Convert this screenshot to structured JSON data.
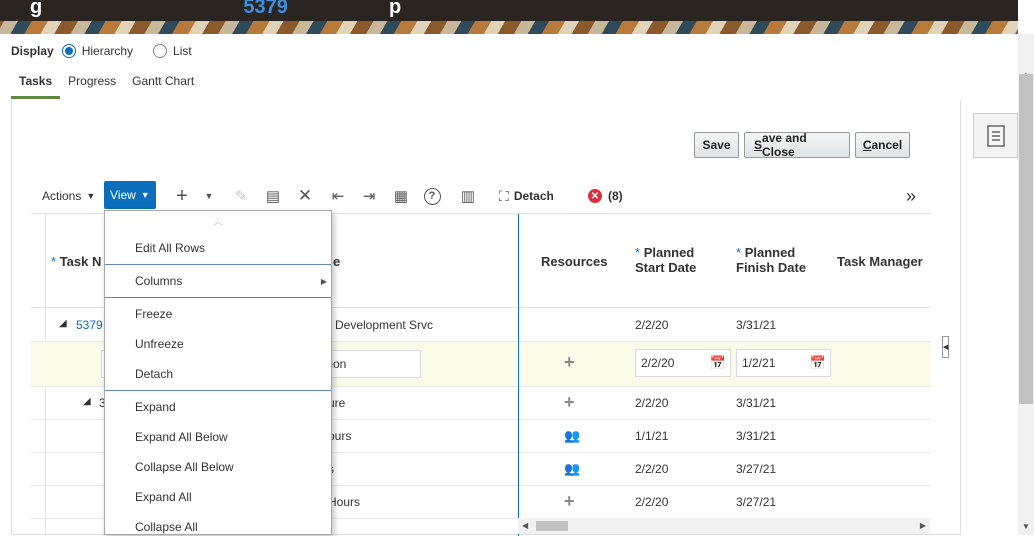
{
  "header": {
    "title_left": "g",
    "title_link": "5379",
    "title_right": "p"
  },
  "display": {
    "label": "Display",
    "options": [
      {
        "label": "Hierarchy",
        "selected": true
      },
      {
        "label": "List",
        "selected": false
      }
    ]
  },
  "tabs": [
    {
      "label": "Tasks",
      "active": true
    },
    {
      "label": "Progress",
      "active": false
    },
    {
      "label": "Gantt Chart",
      "active": false
    }
  ],
  "buttons": {
    "save": "Save",
    "save_close_s": "S",
    "save_close_rest": "ave and Close",
    "cancel_c": "C",
    "cancel_rest": "ancel"
  },
  "toolbar": {
    "actions": "Actions",
    "view": "View",
    "detach": "Detach",
    "error_count": "(8)",
    "overflow": "»"
  },
  "table": {
    "headers": {
      "task_name": "Task N",
      "name_col": "e",
      "resources": "Resources",
      "planned_start_l1": "Planned",
      "planned_start_l2": "Start Date",
      "planned_finish_l1": "Planned",
      "planned_finish_l2": "Finish Date",
      "task_manager": "Task Manager",
      "required_marker": "*"
    },
    "rows": [
      {
        "task": "5379",
        "name": "Development Srvc",
        "start": "2/2/20",
        "finish": "3/31/21"
      },
      {
        "task": "",
        "name": "tion",
        "start": "2/2/20",
        "finish": "1/2/21"
      },
      {
        "task": "3",
        "name": "ure",
        "start": "2/2/20",
        "finish": "3/31/21"
      },
      {
        "task": "",
        "name": "ours",
        "start": "1/1/21",
        "finish": "3/31/21"
      },
      {
        "task": "",
        "name": "s",
        "start": "2/2/20",
        "finish": "3/27/21"
      },
      {
        "task": "",
        "name": "Hours",
        "start": "2/2/20",
        "finish": "3/27/21"
      }
    ]
  },
  "view_menu": {
    "items": [
      "Edit All Rows",
      "Columns",
      "Freeze",
      "Unfreeze",
      "Detach",
      "Expand",
      "Expand All Below",
      "Collapse All Below",
      "Expand All",
      "Collapse All"
    ]
  },
  "colors": {
    "accent": "#0a6ebd",
    "selected_row": "#fafce9",
    "active_tab_underline": "#5b8a40"
  }
}
